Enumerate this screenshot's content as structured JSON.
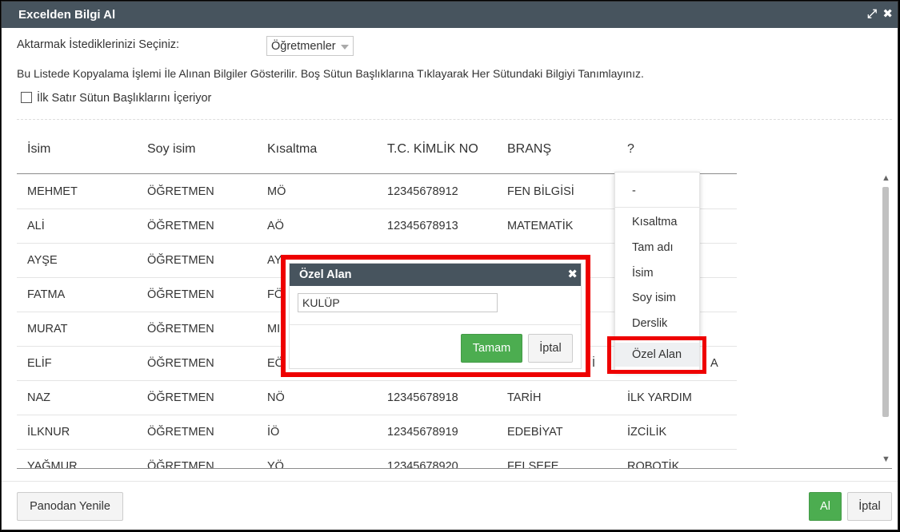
{
  "window": {
    "title": "Excelden Bilgi Al",
    "expand_icon": "expand-icon",
    "close_icon": "close-icon"
  },
  "form": {
    "select_label": "Aktarmak İstediklerinizi Seçiniz:",
    "select_value": "Öğretmenler",
    "info": "Bu Listede Kopyalama İşlemi İle Alınan Bilgiler Gösterilir. Boş Sütun Başlıklarına Tıklayarak Her Sütundaki Bilgiyi Tanımlayınız.",
    "checkbox_label": "İlk Satır Sütun Başlıklarını İçeriyor"
  },
  "table": {
    "headers": [
      "İsim",
      "Soy isim",
      "Kısaltma",
      "T.C. KİMLİK NO",
      "BRANŞ",
      "?"
    ],
    "rows": [
      [
        "MEHMET",
        "ÖĞRETMEN",
        "MÖ",
        "12345678912",
        "FEN BİLGİSİ",
        ""
      ],
      [
        "ALİ",
        "ÖĞRETMEN",
        "AÖ",
        "12345678913",
        "MATEMATİK",
        ""
      ],
      [
        "AYŞE",
        "ÖĞRETMEN",
        "AY",
        "",
        "",
        ""
      ],
      [
        "FATMA",
        "ÖĞRETMEN",
        "FÖ",
        "",
        "",
        ""
      ],
      [
        "MURAT",
        "ÖĞRETMEN",
        "MI",
        "",
        "",
        ""
      ],
      [
        "ELİF",
        "ÖĞRETMEN",
        "EÖ",
        "",
        "İ",
        "A"
      ],
      [
        "NAZ",
        "ÖĞRETMEN",
        "NÖ",
        "12345678918",
        "TARİH",
        "İLK YARDIM"
      ],
      [
        "İLKNUR",
        "ÖĞRETMEN",
        "İÖ",
        "12345678919",
        "EDEBİYAT",
        "İZCİLİK"
      ],
      [
        "YAĞMUR",
        "ÖĞRETMEN",
        "YÖ",
        "12345678920",
        "FELSEFE",
        "ROBOTİK"
      ]
    ]
  },
  "dropdown": {
    "items": [
      "-",
      "Kısaltma",
      "Tam adı",
      "İsim",
      "Soy isim",
      "Derslik",
      "Özel Alan"
    ],
    "selected": "Özel Alan"
  },
  "modal": {
    "title": "Özel Alan",
    "close_icon": "close-icon",
    "input_value": "KULÜP",
    "ok_label": "Tamam",
    "cancel_label": "İptal"
  },
  "footer": {
    "refresh_label": "Panodan Yenile",
    "ok_label": "Al",
    "cancel_label": "İptal"
  },
  "colors": {
    "titlebar": "#47545e",
    "highlight": "#ee0000",
    "primary_button": "#4cad50"
  }
}
